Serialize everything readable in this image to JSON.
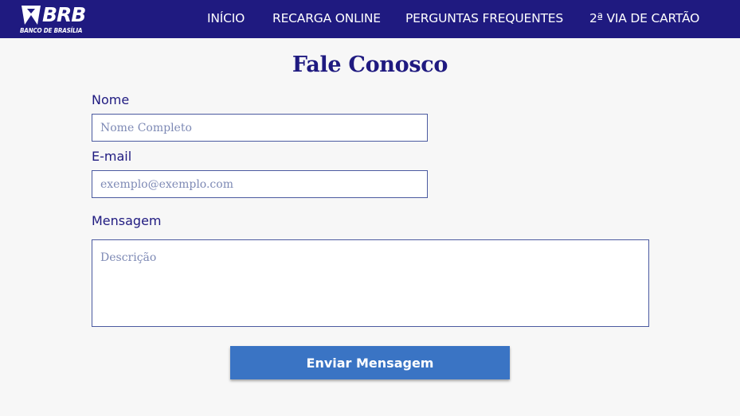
{
  "brand": {
    "name": "BRB",
    "subtitle": "BANCO DE BRASÍLIA"
  },
  "nav": {
    "items": [
      {
        "label": "INÍCIO"
      },
      {
        "label": "RECARGA ONLINE"
      },
      {
        "label": "PERGUNTAS FREQUENTES"
      },
      {
        "label": "2ª VIA DE CARTÃO"
      }
    ]
  },
  "form": {
    "title": "Fale Conosco",
    "name_label": "Nome",
    "name_placeholder": "Nome Completo",
    "email_label": "E-mail",
    "email_placeholder": "exemplo@exemplo.com",
    "message_label": "Mensagem",
    "message_placeholder": "Descrição",
    "submit_label": "Enviar Mensagem"
  },
  "colors": {
    "navbar": "#1f1a80",
    "title": "#1f1a80",
    "button": "#3a74c4",
    "background": "#f7f7f7"
  }
}
